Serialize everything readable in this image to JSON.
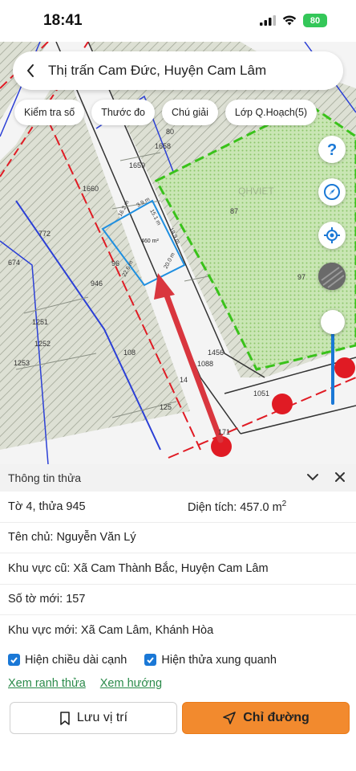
{
  "status_bar": {
    "time": "18:41",
    "battery": "80"
  },
  "header": {
    "title": "Thị trấn Cam Đức, Huyện Cam Lâm",
    "back_icon": "chevron-left-icon"
  },
  "toolbar": {
    "chips": [
      "Kiểm tra số",
      "Thước đo",
      "Chú giải",
      "Lớp Q.Hoạch(5)"
    ]
  },
  "map": {
    "parcel_labels": [
      "80",
      "1658",
      "1659",
      "1660",
      "87",
      "772",
      "674",
      "946",
      "96",
      "97",
      "1251",
      "1252",
      "1253",
      "108",
      "1456",
      "1088",
      "14",
      "1051",
      "125",
      "171"
    ],
    "edge_labels": [
      "16.2 m",
      "3.9 m",
      "15.1 m",
      "19.9 m",
      "20.0 m",
      "22.6 m"
    ],
    "area_label": "460 m²",
    "watermark": "QHVIET"
  },
  "controls": {
    "help_icon": "question-icon",
    "compass_icon": "compass-icon",
    "locate_icon": "locate-icon",
    "layer_icon": "satellite-layer-icon"
  },
  "info": {
    "title": "Thông tin thửa",
    "parcel": "Tờ 4, thửa 945",
    "area_label": "Diện tích: 457.0 m",
    "area_sup": "2",
    "owner": "Tên chủ: Nguyễn Văn Lý",
    "old_area": "Khu vực cũ: Xã Cam Thành Bắc, Huyện Cam Lâm",
    "new_sheet": "Số tờ mới: 157",
    "new_area": "Khu vực mới: Xã Cam Lâm, Khánh Hòa",
    "check_edges": "Hiện chiều dài cạnh",
    "check_neighbors": "Hiện thửa xung quanh",
    "link_boundary": "Xem ranh thửa",
    "link_direction": "Xem hướng",
    "save_label": "Lưu vị trí",
    "directions_label": "Chỉ đường"
  },
  "colors": {
    "accent": "#1a78d6",
    "primary_button": "#f28a2e",
    "link": "#2a8a4a",
    "zone_green": "#39c21a",
    "road_red": "#e01b24"
  }
}
